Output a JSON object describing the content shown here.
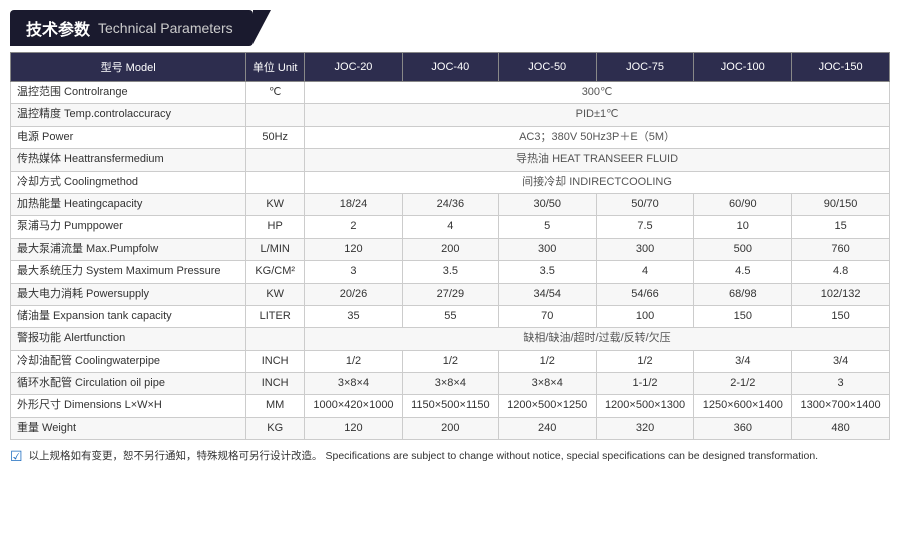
{
  "header": {
    "zh": "技术参数",
    "en": "Technical Parameters"
  },
  "table": {
    "columns": [
      "型号 Model",
      "单位 Unit",
      "JOC-20",
      "JOC-40",
      "JOC-50",
      "JOC-75",
      "JOC-100",
      "JOC-150"
    ],
    "rows": [
      {
        "label": "温控范围 Controlrange",
        "unit": "℃",
        "span": true,
        "spanText": "300℃",
        "values": []
      },
      {
        "label": "温控精度 Temp.controlaccuracy",
        "unit": "",
        "span": true,
        "spanText": "PID±1℃",
        "values": []
      },
      {
        "label": "电源 Power",
        "unit": "50Hz",
        "span": true,
        "spanText": "AC3；380V 50Hz3P＋E（5M）",
        "values": []
      },
      {
        "label": "传热媒体 Heattransfermedium",
        "unit": "",
        "span": true,
        "spanText": "导热油 HEAT TRANSEER FLUID",
        "values": []
      },
      {
        "label": "冷却方式 Coolingmethod",
        "unit": "",
        "span": true,
        "spanText": "间接冷却 INDIRECTCOOLING",
        "values": []
      },
      {
        "label": "加热能量 Heatingcapacity",
        "unit": "KW",
        "span": false,
        "values": [
          "18/24",
          "24/36",
          "30/50",
          "50/70",
          "60/90",
          "90/150"
        ]
      },
      {
        "label": "泵浦马力 Pumppower",
        "unit": "HP",
        "span": false,
        "values": [
          "2",
          "4",
          "5",
          "7.5",
          "10",
          "15"
        ]
      },
      {
        "label": "最大泵浦流量 Max.Pumpfolw",
        "unit": "L/MIN",
        "span": false,
        "values": [
          "120",
          "200",
          "300",
          "300",
          "500",
          "760"
        ]
      },
      {
        "label": "最大系统压力 System Maximum Pressure",
        "unit": "KG/CM²",
        "span": false,
        "values": [
          "3",
          "3.5",
          "3.5",
          "4",
          "4.5",
          "4.8"
        ]
      },
      {
        "label": "最大电力消耗 Powersupply",
        "unit": "KW",
        "span": false,
        "values": [
          "20/26",
          "27/29",
          "34/54",
          "54/66",
          "68/98",
          "102/132"
        ]
      },
      {
        "label": "储油量 Expansion tank capacity",
        "unit": "LITER",
        "span": false,
        "values": [
          "35",
          "55",
          "70",
          "100",
          "150",
          "150"
        ]
      },
      {
        "label": "警报功能 Alertfunction",
        "unit": "",
        "span": true,
        "spanText": "缺相/缺油/超时/过载/反转/欠压",
        "values": []
      },
      {
        "label": "冷却油配管 Coolingwaterpipe",
        "unit": "INCH",
        "span": false,
        "values": [
          "1/2",
          "1/2",
          "1/2",
          "1/2",
          "3/4",
          "3/4"
        ]
      },
      {
        "label": "循环水配管 Circulation oil pipe",
        "unit": "INCH",
        "span": false,
        "values": [
          "3×8×4",
          "3×8×4",
          "3×8×4",
          "1-1/2",
          "2-1/2",
          "3"
        ]
      },
      {
        "label": "外形尺寸 Dimensions L×W×H",
        "unit": "MM",
        "span": false,
        "values": [
          "1000×420×1000",
          "1150×500×1150",
          "1200×500×1250",
          "1200×500×1300",
          "1250×600×1400",
          "1300×700×1400"
        ]
      },
      {
        "label": "重量 Weight",
        "unit": "KG",
        "span": false,
        "values": [
          "120",
          "200",
          "240",
          "320",
          "360",
          "480"
        ]
      }
    ]
  },
  "footer": {
    "text": "以上规格如有变更，恕不另行通知，特殊规格可另行设计改造。  Specifications are subject to change without notice, special specifications can be designed transformation."
  }
}
